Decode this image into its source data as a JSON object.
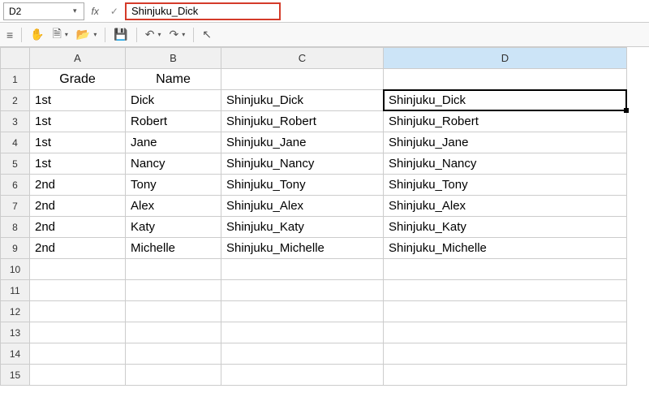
{
  "formula_bar": {
    "name_box_value": "D2",
    "fx_label": "fx",
    "formula_value": "Shinjuku_Dick"
  },
  "columns": [
    "A",
    "B",
    "C",
    "D"
  ],
  "selected_column": "D",
  "active_cell": "D2",
  "row_count": 15,
  "header_row": {
    "A": "Grade",
    "B": "Name",
    "C": "",
    "D": ""
  },
  "data_rows": [
    {
      "A": "1st",
      "B": "Dick",
      "C": "Shinjuku_Dick",
      "D": "Shinjuku_Dick"
    },
    {
      "A": "1st",
      "B": "Robert",
      "C": "Shinjuku_Robert",
      "D": "Shinjuku_Robert"
    },
    {
      "A": "1st",
      "B": "Jane",
      "C": "Shinjuku_Jane",
      "D": "Shinjuku_Jane"
    },
    {
      "A": "1st",
      "B": "Nancy",
      "C": "Shinjuku_Nancy",
      "D": "Shinjuku_Nancy"
    },
    {
      "A": "2nd",
      "B": "Tony",
      "C": "Shinjuku_Tony",
      "D": "Shinjuku_Tony"
    },
    {
      "A": "2nd",
      "B": "Alex",
      "C": "Shinjuku_Alex",
      "D": "Shinjuku_Alex"
    },
    {
      "A": "2nd",
      "B": "Katy",
      "C": "Shinjuku_Katy",
      "D": "Shinjuku_Katy"
    },
    {
      "A": "2nd",
      "B": "Michelle",
      "C": "Shinjuku_Michelle",
      "D": "Shinjuku_Michelle"
    }
  ],
  "icons": {
    "hamburger": "≡",
    "hand": "✋",
    "doc": "🗎",
    "folder": "📂",
    "save": "💾",
    "undo": "↶",
    "redo": "↷",
    "pointer": "↖",
    "check": "✓",
    "dropdown": "▾"
  }
}
